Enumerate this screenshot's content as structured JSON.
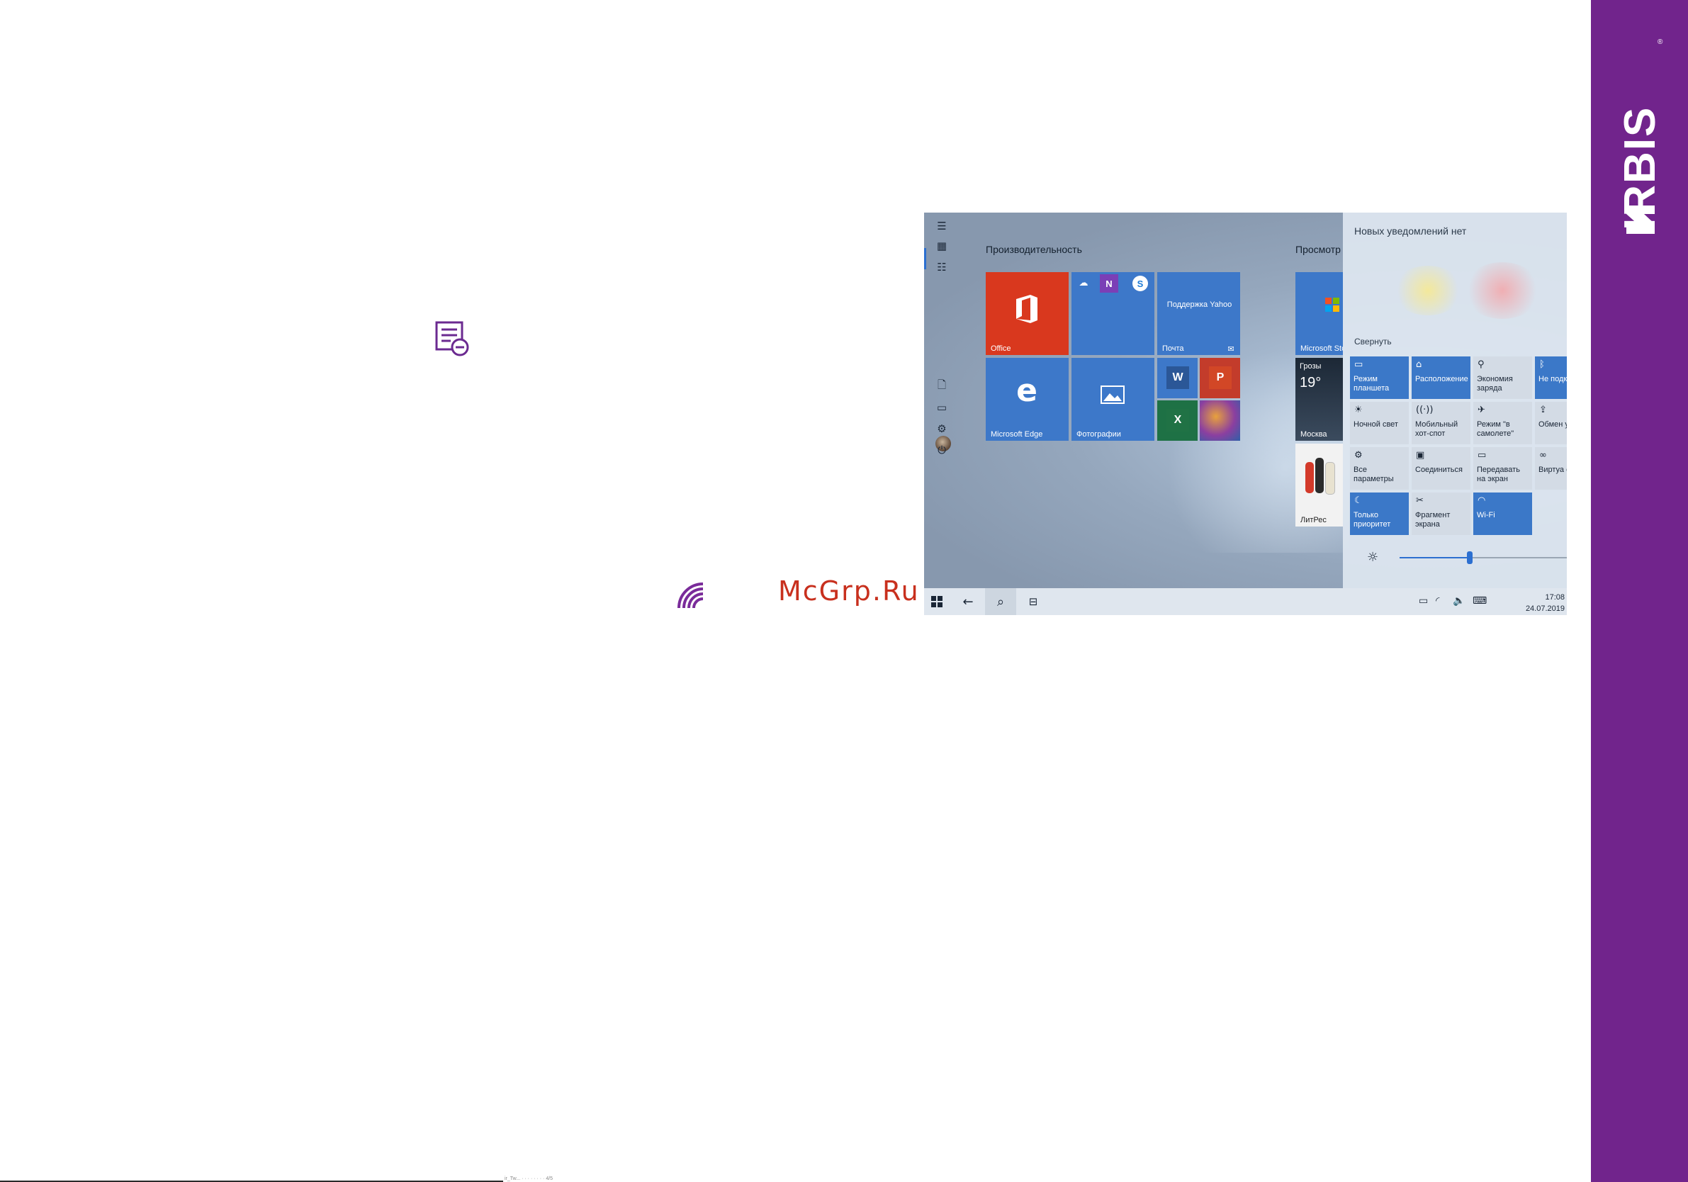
{
  "brand": {
    "name": "IRBIS",
    "color": "#71248c"
  },
  "page": {
    "watermark": "McGrp.Ru",
    "footer_text": "ir_Tw... ·  ·  ·  ·  ·  ·  ·  · 4/5"
  },
  "start": {
    "groups": [
      "Производительность",
      "Просмотр"
    ],
    "tiles": {
      "office": "Office",
      "yahoo": "Поддержка Yahoo",
      "mail": "Почта",
      "edge": "Microsoft Edge",
      "photos": "Фотографии",
      "store": "Microsoft Sto",
      "weather_cond": "Грозы",
      "weather_temp": "19°",
      "weather_city": "Москва",
      "litres": "ЛитРес"
    }
  },
  "action_center": {
    "no_notifications": "Новых уведомлений нет",
    "collapse": "Свернуть",
    "quick_actions": [
      {
        "label": "Режим планшета",
        "on": true,
        "icon": "tablet-icon"
      },
      {
        "label": "Расположение",
        "on": true,
        "icon": "location-icon"
      },
      {
        "label": "Экономия заряда",
        "on": false,
        "icon": "battery-saver-icon"
      },
      {
        "label": "Не подкл",
        "on": true,
        "icon": "bluetooth-icon"
      },
      {
        "label": "Ночной свет",
        "on": false,
        "icon": "night-light-icon"
      },
      {
        "label": "Мобильный хот-спот",
        "on": false,
        "icon": "hotspot-icon"
      },
      {
        "label": "Режим \"в самолете\"",
        "on": false,
        "icon": "airplane-icon"
      },
      {
        "label": "Обмен устрой",
        "on": false,
        "icon": "share-icon"
      },
      {
        "label": "Все параметры",
        "on": false,
        "icon": "settings-icon"
      },
      {
        "label": "Соединиться",
        "on": false,
        "icon": "connect-icon"
      },
      {
        "label": "Передавать на экран",
        "on": false,
        "icon": "project-icon"
      },
      {
        "label": "Виртуа сеть (V",
        "on": false,
        "icon": "vpn-icon"
      },
      {
        "label": "Только приоритет",
        "on": true,
        "icon": "focus-assist-icon"
      },
      {
        "label": "Фрагмент экрана",
        "on": false,
        "icon": "snip-icon"
      },
      {
        "label": "Wi-Fi",
        "on": true,
        "icon": "wifi-icon"
      }
    ],
    "brightness": 0.42
  },
  "taskbar": {
    "time": "17:08",
    "date": "24.07.2019"
  }
}
